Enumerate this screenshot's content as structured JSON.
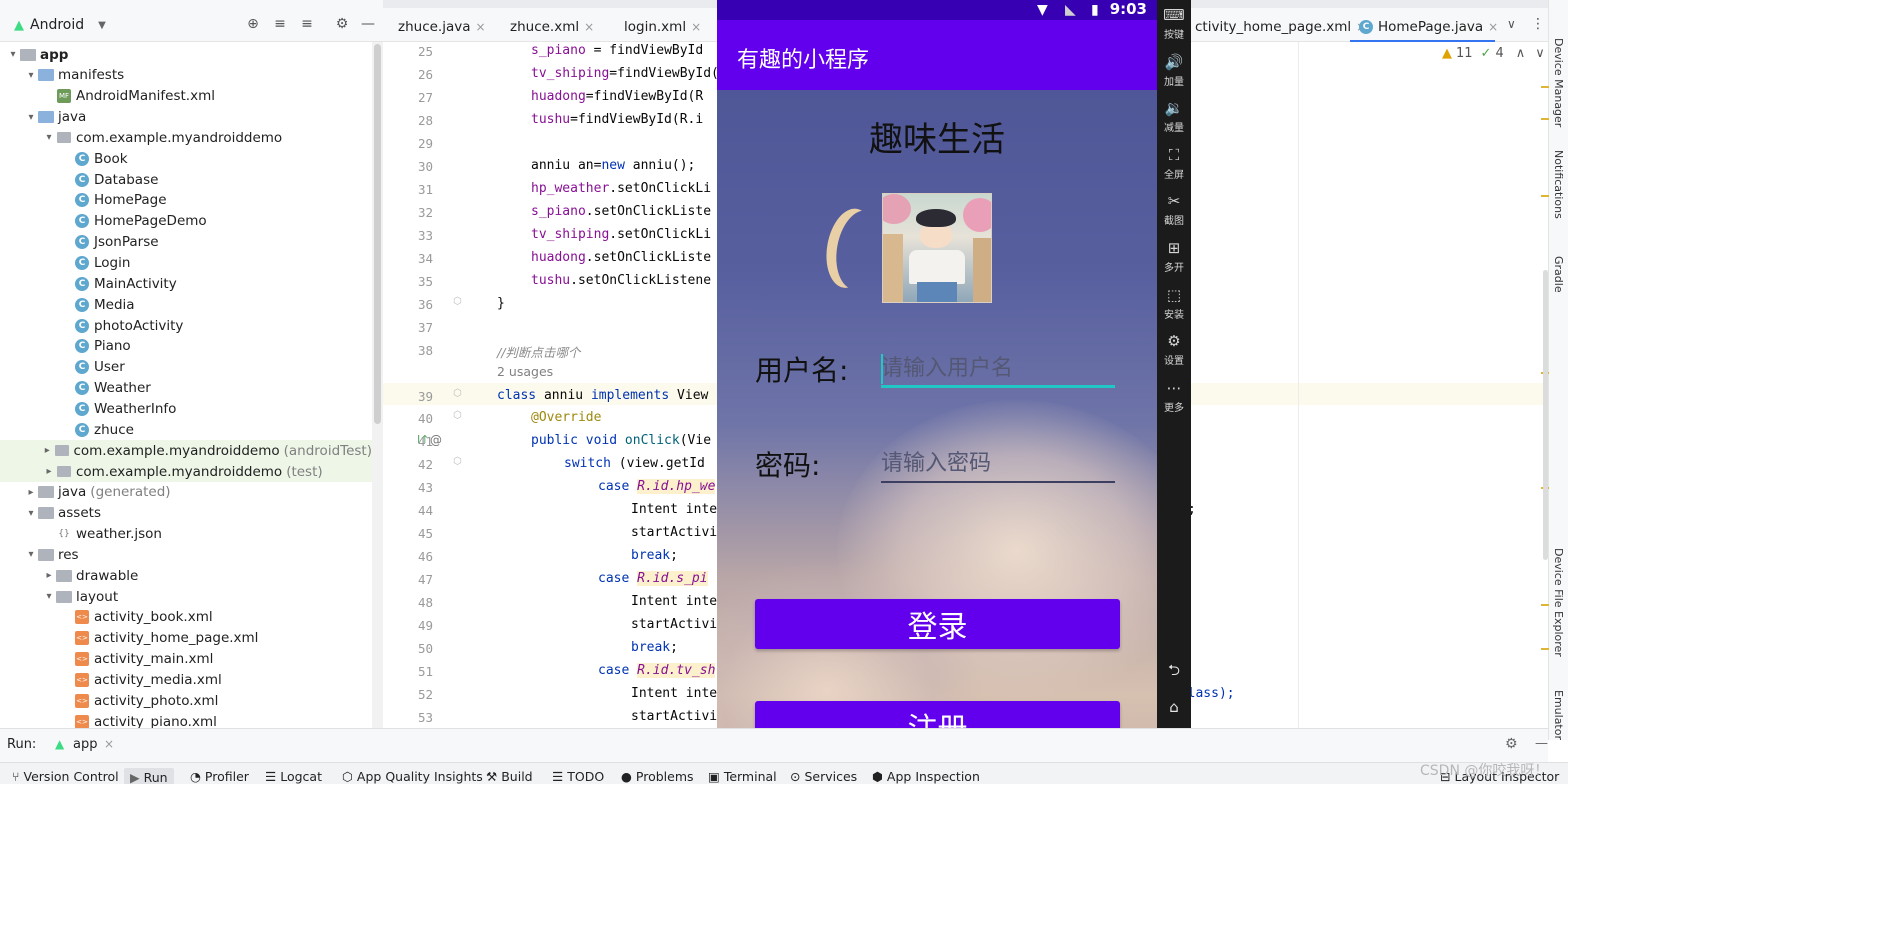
{
  "project": {
    "mode": "Android",
    "tree": [
      {
        "label": "app",
        "bold": true,
        "indent": 0,
        "icon": "folder",
        "open": true
      },
      {
        "label": "manifests",
        "indent": 1,
        "icon": "folder-blue",
        "open": true
      },
      {
        "label": "AndroidManifest.xml",
        "indent": 2,
        "icon": "manifest"
      },
      {
        "label": "java",
        "indent": 1,
        "icon": "folder-blue",
        "open": true
      },
      {
        "label": "com.example.myandroiddemo",
        "indent": 2,
        "icon": "package",
        "open": true
      },
      {
        "label": "Book",
        "indent": 3,
        "icon": "class"
      },
      {
        "label": "Database",
        "indent": 3,
        "icon": "class"
      },
      {
        "label": "HomePage",
        "indent": 3,
        "icon": "class"
      },
      {
        "label": "HomePageDemo",
        "indent": 3,
        "icon": "class"
      },
      {
        "label": "JsonParse",
        "indent": 3,
        "icon": "class"
      },
      {
        "label": "Login",
        "indent": 3,
        "icon": "class"
      },
      {
        "label": "MainActivity",
        "indent": 3,
        "icon": "class"
      },
      {
        "label": "Media",
        "indent": 3,
        "icon": "class"
      },
      {
        "label": "photoActivity",
        "indent": 3,
        "icon": "class"
      },
      {
        "label": "Piano",
        "indent": 3,
        "icon": "class"
      },
      {
        "label": "User",
        "indent": 3,
        "icon": "class"
      },
      {
        "label": "Weather",
        "indent": 3,
        "icon": "class"
      },
      {
        "label": "WeatherInfo",
        "indent": 3,
        "icon": "class"
      },
      {
        "label": "zhuce",
        "indent": 3,
        "icon": "class"
      },
      {
        "label": "com.example.myandroiddemo",
        "suffix": "(androidTest)",
        "indent": 2,
        "icon": "package",
        "closed": true,
        "hl": true
      },
      {
        "label": "com.example.myandroiddemo",
        "suffix": "(test)",
        "indent": 2,
        "icon": "package",
        "closed": true,
        "hl": true
      },
      {
        "label": "java",
        "suffix": "(generated)",
        "indent": 1,
        "icon": "folder",
        "closed": true
      },
      {
        "label": "assets",
        "indent": 1,
        "icon": "folder",
        "open": true
      },
      {
        "label": "weather.json",
        "indent": 2,
        "icon": "json"
      },
      {
        "label": "res",
        "indent": 1,
        "icon": "folder",
        "open": true
      },
      {
        "label": "drawable",
        "indent": 2,
        "icon": "folder",
        "closed": true
      },
      {
        "label": "layout",
        "indent": 2,
        "icon": "folder",
        "open": true
      },
      {
        "label": "activity_book.xml",
        "indent": 3,
        "icon": "xml"
      },
      {
        "label": "activity_home_page.xml",
        "indent": 3,
        "icon": "xml"
      },
      {
        "label": "activity_main.xml",
        "indent": 3,
        "icon": "xml"
      },
      {
        "label": "activity_media.xml",
        "indent": 3,
        "icon": "xml"
      },
      {
        "label": "activity_photo.xml",
        "indent": 3,
        "icon": "xml"
      },
      {
        "label": "activity_piano.xml",
        "indent": 3,
        "icon": "xml"
      }
    ]
  },
  "tabs": {
    "zhuce_java": "zhuce.java",
    "zhuce_xml": "zhuce.xml",
    "login_xml": "login.xml",
    "home_xml": "ctivity_home_page.xml",
    "homepage_java": "HomePage.java"
  },
  "editor": {
    "line_numbers": [
      "25",
      "26",
      "27",
      "28",
      "29",
      "30",
      "31",
      "32",
      "33",
      "34",
      "35",
      "36",
      "37",
      "38",
      "39",
      "40",
      "41",
      "42",
      "43",
      "44",
      "45",
      "46",
      "47",
      "48",
      "49",
      "50",
      "51",
      "52",
      "53"
    ],
    "usages": "2 usages",
    "comment": "//判断点击哪个",
    "warnings": "11",
    "checks": "4",
    "tail_44": ";",
    "tail_52": ".class);"
  },
  "emulator": {
    "time": "9:03",
    "app_title": "有趣的小程序",
    "headline": "趣味生活",
    "username_label": "用户名:",
    "username_placeholder": "请输入用户名",
    "password_label": "密码:",
    "password_placeholder": "请输入密码",
    "login_button": "登录",
    "register_button": "注册",
    "panel": [
      {
        "glyph": "⌨",
        "label": "按键"
      },
      {
        "glyph": "🔊",
        "label": "加量"
      },
      {
        "glyph": "🔉",
        "label": "减量"
      },
      {
        "glyph": "⛶",
        "label": "全屏"
      },
      {
        "glyph": "✂",
        "label": "截图"
      },
      {
        "glyph": "⊞",
        "label": "多开"
      },
      {
        "glyph": "⬚",
        "label": "安装"
      },
      {
        "glyph": "⚙",
        "label": "设置"
      },
      {
        "glyph": "⋯",
        "label": "更多"
      }
    ]
  },
  "run": {
    "label": "Run:",
    "config": "app"
  },
  "bottom_tools": [
    "Version Control",
    "Run",
    "Profiler",
    "Logcat",
    "App Quality Insights",
    "Build",
    "TODO",
    "Problems",
    "Terminal",
    "Services",
    "App Inspection",
    "Layout Inspector"
  ],
  "right_tools": [
    "Device Manager",
    "Notifications",
    "Gradle",
    "Device File Explorer",
    "Emulator"
  ],
  "watermark": "CSDN @你咬我呀！"
}
